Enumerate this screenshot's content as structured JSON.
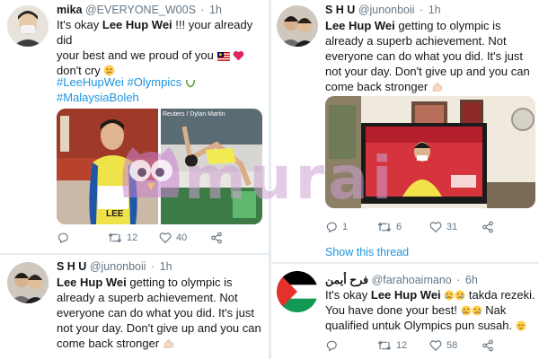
{
  "tweets": {
    "mika": {
      "display_name": "mika",
      "handle": "@EVERYONE_W00S",
      "separator": "·",
      "time": "1h",
      "line1_pre": "It's okay ",
      "line1_bold": "Lee Hup Wei",
      "line1_post": " !!! your already did",
      "line2": "your best and we proud of you",
      "line3": "don't cry",
      "hashtags_line1": "#LeeHupWei #Olympics",
      "hashtags_line2": "#MalaysiaBoleh",
      "media_caption": "Reuters / Dylan Martin",
      "bib_text": "LEE",
      "replies": "",
      "retweets": "12",
      "likes": "40"
    },
    "shu_right": {
      "display_name": "S H U",
      "handle": "@junonboii",
      "separator": "·",
      "time": "1h",
      "line1_bold": "Lee Hup Wei",
      "line1_post": " getting to olympic is",
      "line2": "already a superb achievement. Not",
      "line3": "everyone can do what you did. It's just",
      "line4": "not your day. Don't give up and you can",
      "line5": "come back stronger",
      "replies": "1",
      "retweets": "6",
      "likes": "31",
      "show_thread": "Show this thread"
    },
    "shu_left": {
      "display_name": "S H U",
      "handle": "@junonboii",
      "separator": "·",
      "time": "1h",
      "line1_bold": "Lee Hup Wei",
      "line1_post": " getting to olympic is",
      "line2": "already a superb achievement. Not",
      "line3": "everyone can do what you did. It's just",
      "line4": "not your day. Don't give up and you can",
      "line5": "come back stronger"
    },
    "farah": {
      "display_name": "فرح أيمن",
      "handle": "@farahoaimano",
      "separator": "·",
      "time": "6h",
      "line1_pre": "It's okay ",
      "line1_bold": "Lee Hup Wei",
      "line1_post": " takda rezeki.",
      "line2": "You have done your best!",
      "line3": "Nak",
      "line4": "qualified untuk Olympics pun susah.",
      "replies": "",
      "retweets": "12",
      "likes": "58"
    }
  },
  "watermark": "murai",
  "colors": {
    "link": "#1b95e0",
    "text": "#14171a",
    "muted": "#657786",
    "divider": "#e6ecf0"
  },
  "icons": [
    "reply-icon",
    "retweet-icon",
    "like-icon",
    "share-icon",
    "flag-icon",
    "heart-emoji",
    "wreath-emoji",
    "muscle-emoji",
    "crying-emoji"
  ]
}
